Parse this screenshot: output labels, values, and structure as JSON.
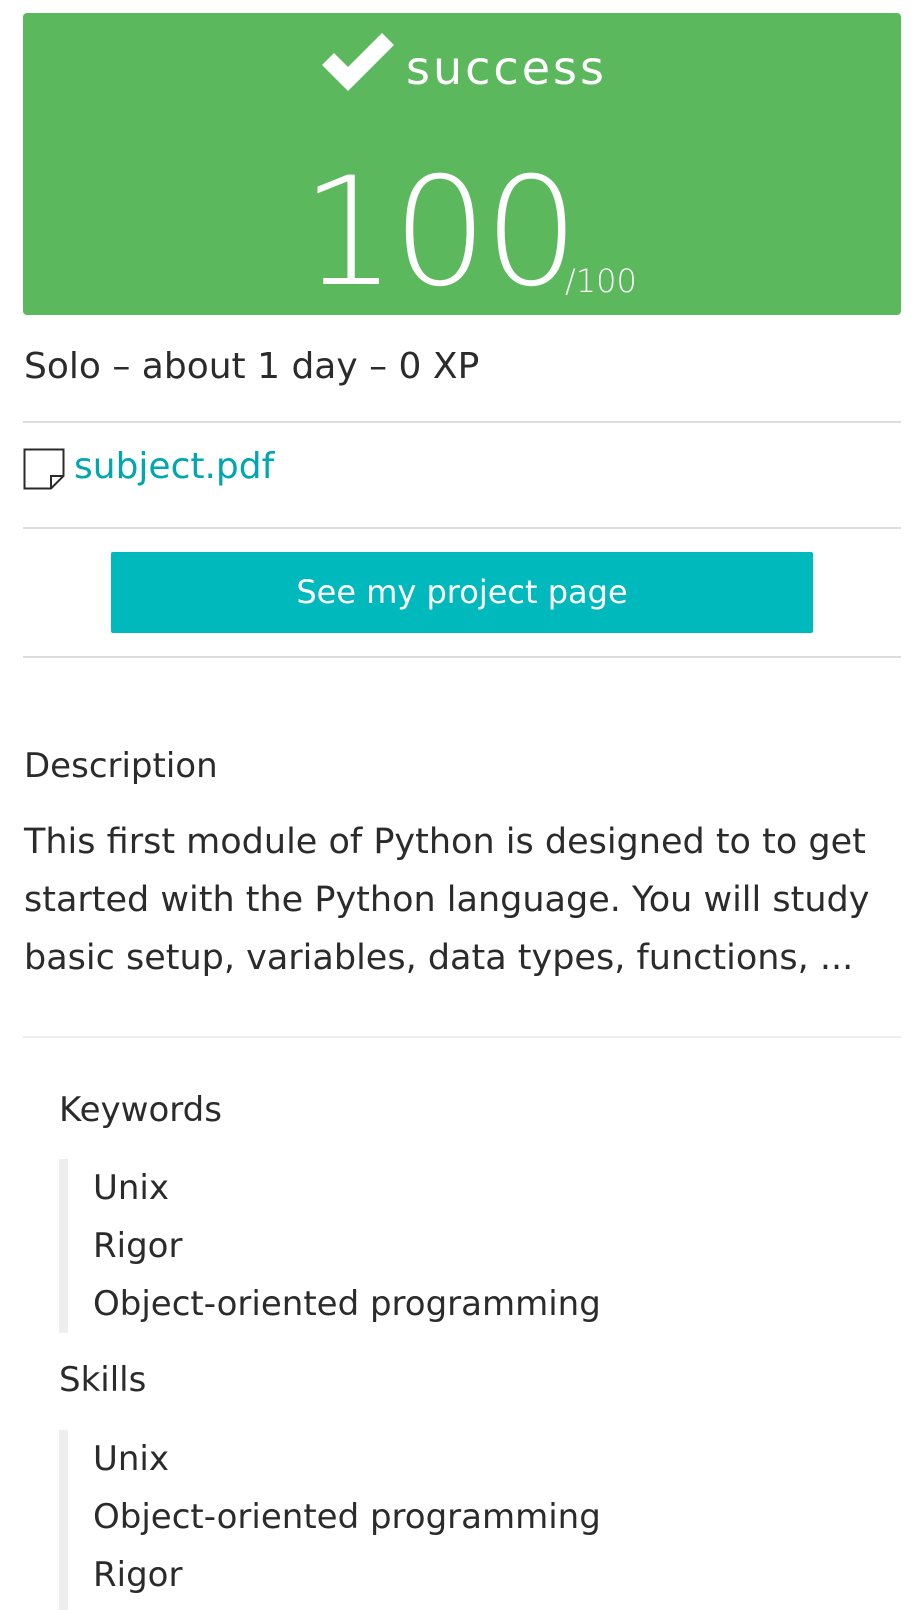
{
  "result": {
    "status": "success",
    "score": "100",
    "max_score": "/100",
    "accent_color": "#5cb85c"
  },
  "project": {
    "meta": "Solo – about 1 day – 0 XP",
    "attachment": "subject.pdf",
    "project_button": "See my project page",
    "button_color": "#00b9bc",
    "link_color": "#00a7b0"
  },
  "description": {
    "title": "Description",
    "text": "This first module of Python is designed to to get started with the Python language. You will study basic setup, variables, data types, functions, ..."
  },
  "keywords": {
    "title": "Keywords",
    "items": [
      "Unix",
      "Rigor",
      "Object-oriented programming"
    ]
  },
  "skills": {
    "title": "Skills",
    "items": [
      "Unix",
      "Object-oriented programming",
      "Rigor"
    ]
  },
  "icons": {
    "status": "checkmark-icon",
    "attachment": "document-icon"
  }
}
